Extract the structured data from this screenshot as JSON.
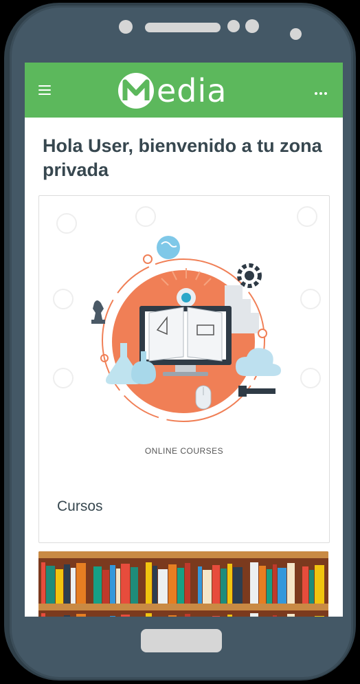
{
  "app": {
    "brand_name": "edia",
    "brand_initial": "M"
  },
  "page": {
    "greeting": "Hola User, bienvenido a tu zona privada"
  },
  "cards": [
    {
      "caption": "ONLINE COURSES",
      "title": "Cursos",
      "image": "online-courses-illustration"
    },
    {
      "image": "bookshelf-image"
    }
  ],
  "colors": {
    "appbar": "#5cb85c",
    "title_text": "#37474f",
    "phone_body": "#445866",
    "accent_orange": "#f07f56"
  },
  "icons": {
    "menu": "hamburger-menu-icon",
    "more": "more-dots-icon"
  }
}
